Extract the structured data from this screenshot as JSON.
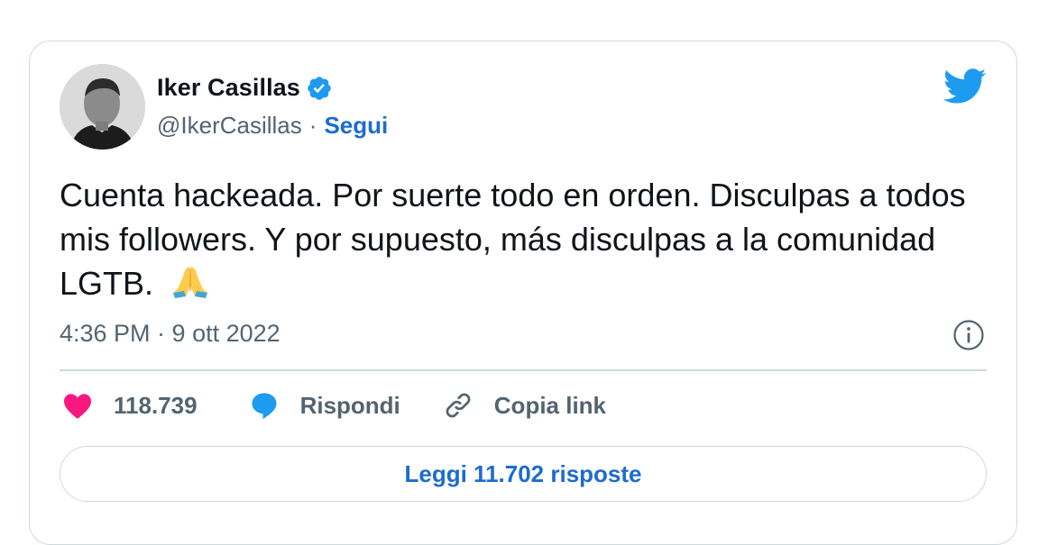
{
  "author": {
    "name": "Iker Casillas",
    "handle": "@IkerCasillas",
    "separator": "·",
    "follow_label": "Segui"
  },
  "tweet": {
    "text": "Cuenta hackeada. Por suerte todo en orden. Disculpas a todos mis followers. Y por supuesto, más disculpas a la comunidad LGTB.",
    "emoji": "folded-hands-icon",
    "timestamp": "4:36 PM · 9 ott 2022"
  },
  "actions": {
    "likes_count": "118.739",
    "reply_label": "Rispondi",
    "copy_link_label": "Copia link"
  },
  "read_replies_label": "Leggi 11.702 risposte",
  "colors": {
    "accent": "#1d6ccd",
    "twitter_blue": "#1d9bf0",
    "like_pink": "#f91880",
    "secondary_text": "#536471",
    "border": "#cfd9de"
  }
}
